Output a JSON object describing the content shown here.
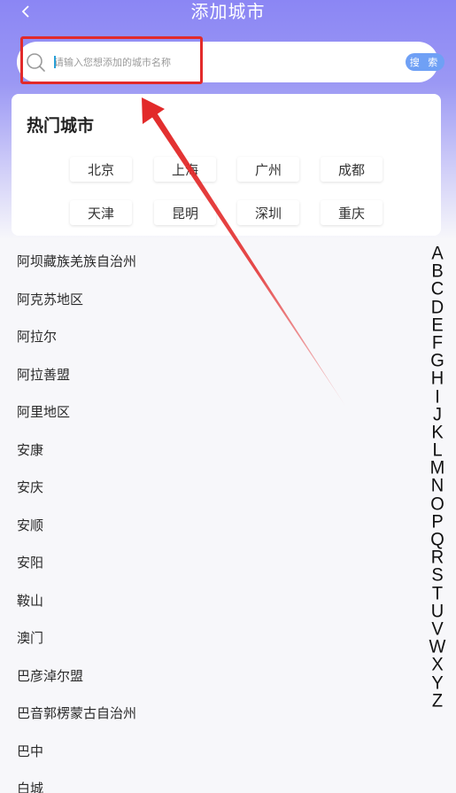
{
  "header": {
    "title": "添加城市"
  },
  "search": {
    "placeholder": "请输入您想添加的城市名称",
    "button_label": "搜 索"
  },
  "hot_cities": {
    "title": "热门城市",
    "items": [
      "北京",
      "上海",
      "广州",
      "成都",
      "天津",
      "昆明",
      "深圳",
      "重庆"
    ]
  },
  "city_list": [
    "阿坝藏族羌族自治州",
    "阿克苏地区",
    "阿拉尔",
    "阿拉善盟",
    "阿里地区",
    "安康",
    "安庆",
    "安顺",
    "安阳",
    "鞍山",
    "澳门",
    "巴彦淖尔盟",
    "巴音郭楞蒙古自治州",
    "巴中",
    "白城"
  ],
  "alphabet_index": [
    "A",
    "B",
    "C",
    "D",
    "E",
    "F",
    "G",
    "H",
    "I",
    "J",
    "K",
    "L",
    "M",
    "N",
    "O",
    "P",
    "Q",
    "R",
    "S",
    "T",
    "U",
    "V",
    "W",
    "X",
    "Y",
    "Z"
  ],
  "colors": {
    "header_gradient_top": "#8b86f4",
    "annotation_red": "#e22a2a",
    "search_button": "#6fa0f5"
  }
}
